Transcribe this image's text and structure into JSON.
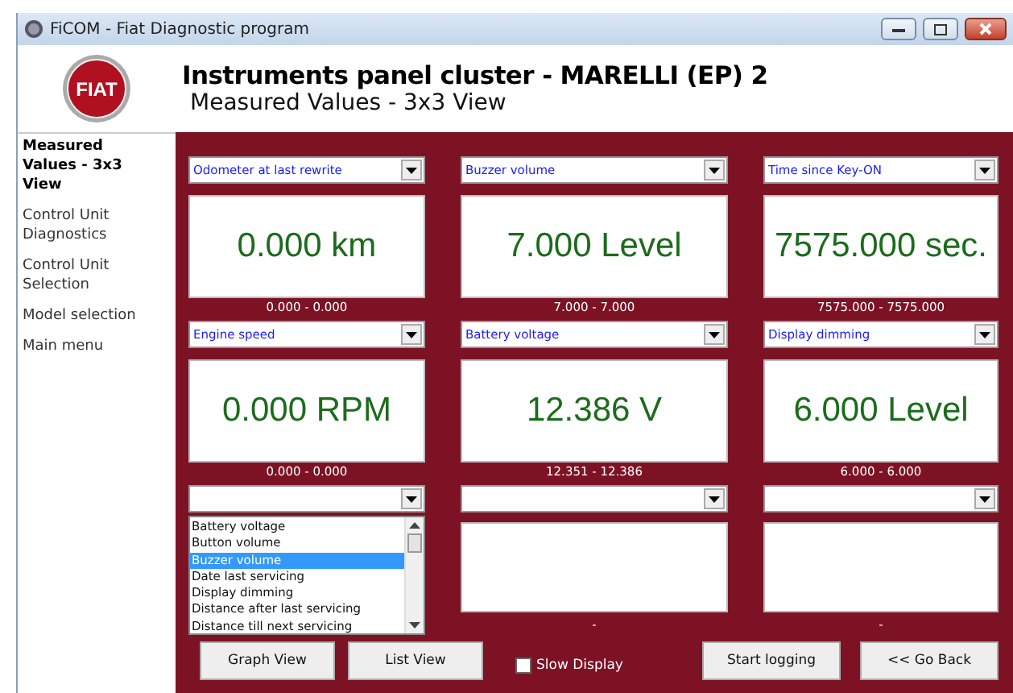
{
  "window": {
    "title": "FiCOM - Fiat Diagnostic program"
  },
  "logo": {
    "text": "FIAT"
  },
  "header": {
    "title": "Instruments panel cluster - MARELLI (EP) 2",
    "subtitle": "Measured Values - 3x3 View"
  },
  "sidebar": {
    "items": [
      {
        "label": "Measured Values - 3x3 View",
        "selected": true
      },
      {
        "label": "Control Unit Diagnostics",
        "selected": false
      },
      {
        "label": "Control Unit Selection",
        "selected": false
      },
      {
        "label": "Model selection",
        "selected": false
      },
      {
        "label": "Main menu",
        "selected": false
      }
    ]
  },
  "cells": [
    {
      "kind": "value",
      "selector": "Odometer at last rewrite",
      "reading": "0.000 km",
      "range": "0.000 - 0.000"
    },
    {
      "kind": "value",
      "selector": "Buzzer volume",
      "reading": "7.000 Level",
      "range": "7.000 - 7.000"
    },
    {
      "kind": "value",
      "selector": "Time since Key-ON",
      "reading": "7575.000 sec.",
      "range": "7575.000 - 7575.000"
    },
    {
      "kind": "value",
      "selector": "Engine speed",
      "reading": "0.000 RPM",
      "range": "0.000 - 0.000"
    },
    {
      "kind": "value",
      "selector": "Battery voltage",
      "reading": "12.386 V",
      "range": "12.351 - 12.386"
    },
    {
      "kind": "value",
      "selector": "Display dimming",
      "reading": "6.000 Level",
      "range": "6.000 - 6.000"
    },
    {
      "kind": "listbox",
      "options": [
        {
          "label": "Battery voltage",
          "selected": false
        },
        {
          "label": "Button volume",
          "selected": false
        },
        {
          "label": "Buzzer volume",
          "selected": true
        },
        {
          "label": "Date last servicing",
          "selected": false
        },
        {
          "label": "Display dimming",
          "selected": false
        },
        {
          "label": "Distance after last servicing",
          "selected": false
        },
        {
          "label": "Distance till next servicing",
          "selected": false
        }
      ]
    },
    {
      "kind": "value",
      "range": "-"
    },
    {
      "kind": "value",
      "range": "-"
    }
  ],
  "buttons_left": [
    "Graph View",
    "List View"
  ],
  "slow_display": {
    "label": "Slow Display",
    "checked": false
  },
  "buttons_right": [
    "Start logging",
    "<< Go Back"
  ]
}
